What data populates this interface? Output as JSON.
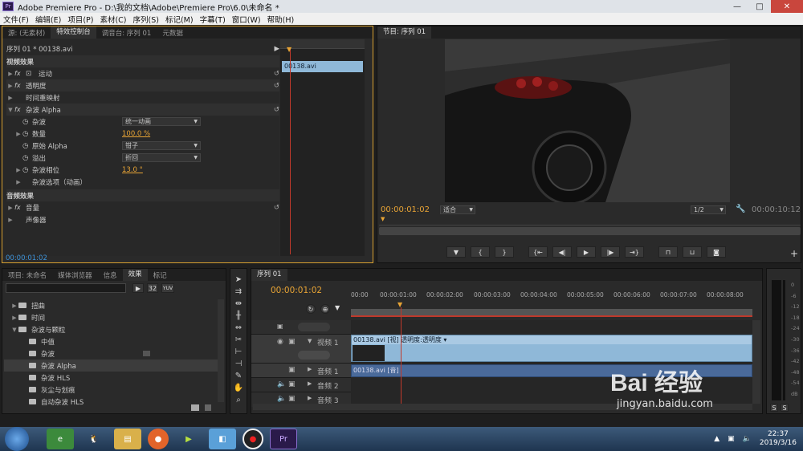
{
  "window": {
    "title": "Adobe Premiere Pro - D:\\我的文档\\Adobe\\Premiere Pro\\6.0\\未命名 *",
    "min": "—",
    "max": "□",
    "close": "✕",
    "app_icon": "Pr"
  },
  "menu": [
    "文件(F)",
    "编辑(E)",
    "项目(P)",
    "素材(C)",
    "序列(S)",
    "标记(M)",
    "字幕(T)",
    "窗口(W)",
    "帮助(H)"
  ],
  "effect_controls": {
    "tabs": [
      "源: (无素材)",
      "特效控制台",
      "调音台: 序列 01",
      "元数据"
    ],
    "sequence_label": "序列 01 * 00138.avi",
    "clip_label": "00138.avi",
    "video_header": "视频效果",
    "audio_header": "音频效果",
    "effects": [
      "运动",
      "透明度",
      "时间重映射"
    ],
    "noise_alpha": {
      "name": "杂波 Alpha",
      "params": [
        {
          "label": "杂波",
          "value": "统一动画"
        },
        {
          "label": "数量",
          "value": "100.0 %"
        },
        {
          "label": "原始 Alpha",
          "value": "钳子"
        },
        {
          "label": "溢出",
          "value": "折回"
        },
        {
          "label": "杂波相位",
          "value": "13.0 °"
        },
        {
          "label": "杂波选项（动画）",
          "value": ""
        }
      ]
    },
    "audio_effects": [
      "音量",
      "声像器"
    ],
    "timecode": "00:00:01:02"
  },
  "program": {
    "tab": "节目: 序列 01",
    "timecode": "00:00:01:02",
    "fit": "适合",
    "ratio": "1/2",
    "duration": "00:00:10:12",
    "controls": [
      "marker-icon",
      "in-icon",
      "out-icon",
      "goto-in-icon",
      "step-back-icon",
      "play-icon",
      "step-forward-icon",
      "goto-out-icon",
      "lift-icon",
      "extract-icon",
      "camera-icon"
    ]
  },
  "project": {
    "tabs": [
      "项目: 未命名",
      "媒体浏览器",
      "信息",
      "效果",
      "标记"
    ],
    "items": [
      {
        "type": "folder",
        "label": "扭曲",
        "expanded": false
      },
      {
        "type": "folder",
        "label": "时间",
        "expanded": false
      },
      {
        "type": "folder",
        "label": "杂波与颗粒",
        "expanded": true
      },
      {
        "type": "fx",
        "label": "中值"
      },
      {
        "type": "fx",
        "label": "杂波"
      },
      {
        "type": "fx",
        "label": "杂波 Alpha",
        "selected": true
      },
      {
        "type": "fx",
        "label": "杂波 HLS"
      },
      {
        "type": "fx",
        "label": "灰尘与划痕"
      },
      {
        "type": "fx",
        "label": "自动杂波 HLS"
      }
    ],
    "badges": [
      "32",
      "YUV"
    ]
  },
  "timeline": {
    "tab": "序列 01",
    "timecode": "00:00:01:02",
    "ruler": [
      "00:00",
      "00:00:01:00",
      "00:00:02:00",
      "00:00:03:00",
      "00:00:04:00",
      "00:00:05:00",
      "00:00:06:00",
      "00:00:07:00",
      "00:00:08:00"
    ],
    "video_track": "视频 1",
    "video_clip": "00138.avi [视] 透明度:透明度 ▾",
    "audio_tracks": [
      "音频 1",
      "音频 2",
      "音频 3"
    ],
    "audio_clip": "00138.avi [音]"
  },
  "meter": {
    "labels": [
      "0",
      "-6",
      "-12",
      "-18",
      "-24",
      "-30",
      "-36",
      "-42",
      "-48",
      "-54",
      "dB"
    ],
    "solo": [
      "S",
      "S"
    ]
  },
  "taskbar": {
    "time": "22:37",
    "date": "2019/3/16",
    "apps": [
      "ie-icon",
      "qq-icon",
      "explorer-icon",
      "firefox-icon",
      "media-icon",
      "files-icon",
      "record-icon",
      "premiere-icon"
    ]
  },
  "watermark": {
    "logo": "Bai 经验",
    "url": "jingyan.baidu.com"
  },
  "colors": {
    "accent": "#e8a435",
    "timecode": "#3e93d9",
    "clip": "#8fb8d8",
    "audio_clip": "#4a6a9a",
    "playhead": "#c0392b"
  }
}
